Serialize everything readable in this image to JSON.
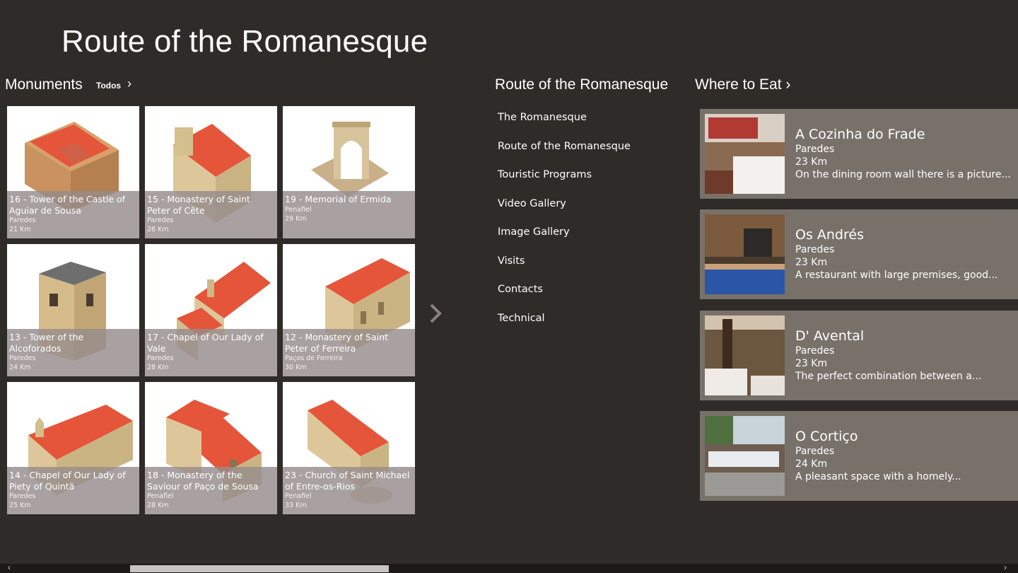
{
  "app": {
    "title": "Route of the Romanesque"
  },
  "monuments": {
    "header": "Monuments",
    "todos_label": "Todos",
    "tiles": [
      {
        "title": "16 - Tower of the Castle of Aguiar de Sousa",
        "place": "Paredes",
        "distance": "21 Km"
      },
      {
        "title": "15 - Monastery of Saint Peter of Cête",
        "place": "Paredes",
        "distance": "26 Km"
      },
      {
        "title": "19 - Memorial of Ermida",
        "place": "Penafiel",
        "distance": "29 Km"
      },
      {
        "title": "13 - Tower of the Alcoforados",
        "place": "Paredes",
        "distance": "24 Km"
      },
      {
        "title": "17 - Chapel of Our Lady of Vale",
        "place": "Paredes",
        "distance": "28 Km"
      },
      {
        "title": "12 - Monastery of Saint Peter of Ferreira",
        "place": "Paços de Ferreira",
        "distance": "30 Km"
      },
      {
        "title": "14 - Chapel of Our Lady of Piety of Quintã",
        "place": "Paredes",
        "distance": "25 Km"
      },
      {
        "title": "18 - Monastery of the Saviour of Paço de Sousa",
        "place": "Penafiel",
        "distance": "28 Km"
      },
      {
        "title": "23 - Church of Saint Michael of Entre-os-Rios",
        "place": "Penafiel",
        "distance": "33 Km"
      }
    ]
  },
  "route": {
    "header": "Route of the Romanesque",
    "items": [
      {
        "label": "The Romanesque"
      },
      {
        "label": "Route of the Romanesque"
      },
      {
        "label": "Touristic Programs"
      },
      {
        "label": "Video Gallery"
      },
      {
        "label": "Image Gallery"
      },
      {
        "label": "Visits"
      },
      {
        "label": "Contacts"
      },
      {
        "label": "Technical"
      }
    ]
  },
  "eat": {
    "header": "Where to Eat ›",
    "cards": [
      {
        "name": "A Cozinha do Frade",
        "place": "Paredes",
        "distance": "23 Km",
        "desc": "On the dining room wall there is a picture..."
      },
      {
        "name": "Os Andrés",
        "place": "Paredes",
        "distance": "23 Km",
        "desc": "A restaurant with large premises, good..."
      },
      {
        "name": "D' Avental",
        "place": "Paredes",
        "distance": "23 Km",
        "desc": "The perfect combination between a..."
      },
      {
        "name": "O Cortiço",
        "place": "Paredes",
        "distance": "24 Km",
        "desc": "A pleasant space with a homely..."
      }
    ]
  },
  "scroll": {
    "left_arrow": "‹",
    "right_arrow": "›"
  },
  "icons": {
    "todos": "chevron-right-icon",
    "pager": "chevron-right-icon"
  },
  "colors": {
    "background": "#2f2b28",
    "card": "#78716a",
    "caption": "#968c8c",
    "roof": "#e4553a"
  }
}
